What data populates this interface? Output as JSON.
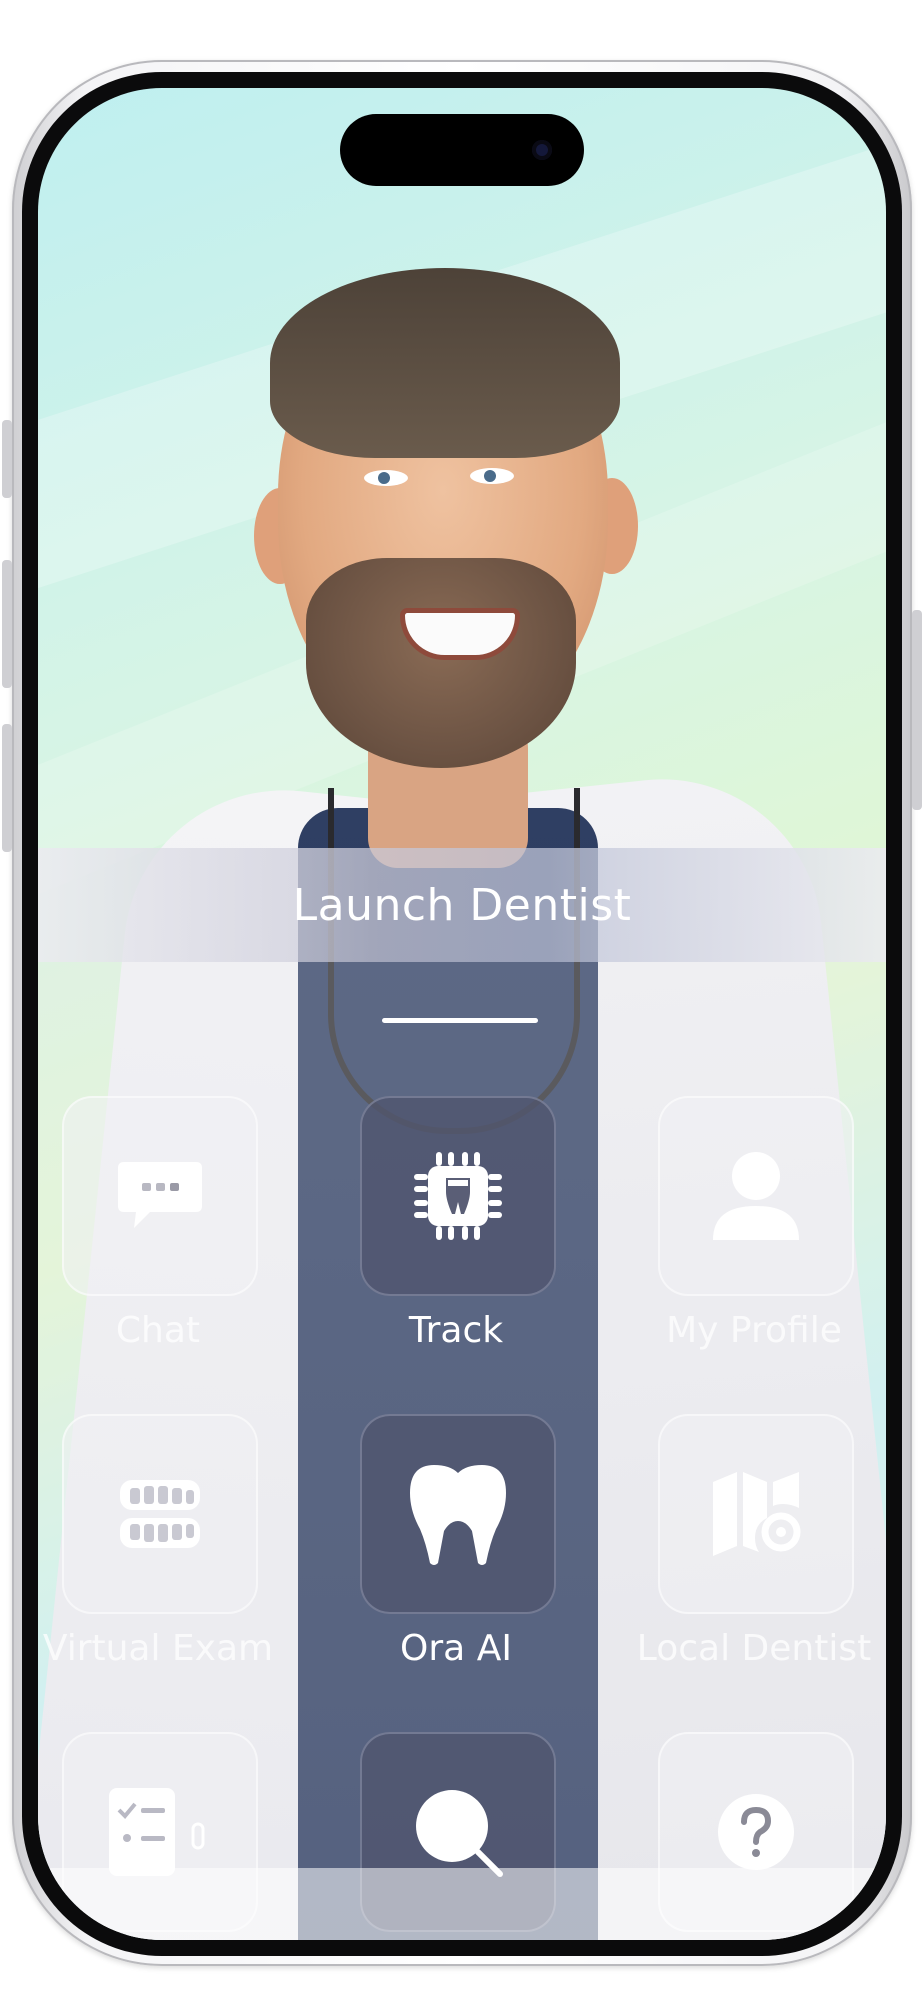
{
  "launch": {
    "label": "Launch Dentist"
  },
  "grid": {
    "rows": [
      [
        {
          "label": "Chat",
          "icon": "chat-bubble-icon"
        },
        {
          "label": "Track",
          "icon": "chip-icon"
        },
        {
          "label": "My Profile",
          "icon": "person-icon"
        }
      ],
      [
        {
          "label": "Virtual Exam",
          "icon": "teeth-rows-icon"
        },
        {
          "label": "Ora AI",
          "icon": "tooth-icon"
        },
        {
          "label": "Local Dentist",
          "icon": "map-icon"
        }
      ],
      [
        {
          "label": "",
          "icon": "checklist-icon"
        },
        {
          "label": "",
          "icon": "magnifier-icon"
        },
        {
          "label": "",
          "icon": "help-icon"
        }
      ]
    ]
  }
}
